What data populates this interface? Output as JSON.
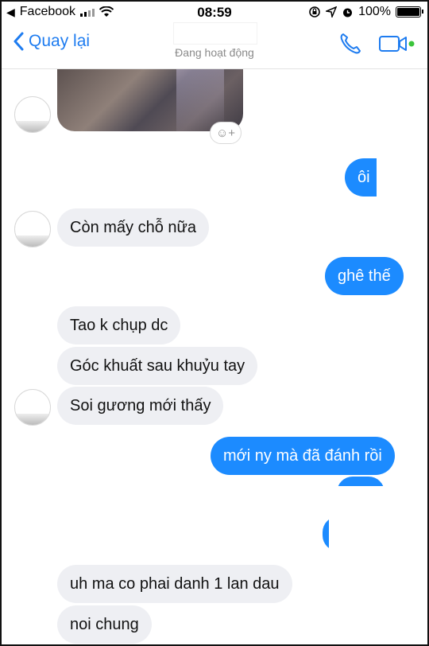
{
  "status_bar": {
    "carrier": "Facebook",
    "time": "08:59",
    "battery": "100%"
  },
  "nav": {
    "back_label": "Quay lại",
    "active_status": "Đang hoạt động"
  },
  "messages": [
    {
      "side": "in",
      "text": "Còn mấy chỗ nữa"
    },
    {
      "side": "out",
      "text": "ôi"
    },
    {
      "side": "out",
      "text": "ghê thế"
    },
    {
      "side": "in",
      "text": "Tao k chụp dc"
    },
    {
      "side": "in",
      "text": "Góc khuất sau khuỷu tay"
    },
    {
      "side": "in",
      "text": "Soi gương mới thấy"
    },
    {
      "side": "out",
      "text": "mới ny mà đã đánh rồi"
    },
    {
      "side": "in",
      "text": "uh ma co phai danh 1 lan dau"
    },
    {
      "side": "in",
      "text": "noi chung"
    }
  ],
  "colors": {
    "accent": "#1e7cf0",
    "outgoing_bubble": "#1c8bff",
    "incoming_bubble": "#eeeff3",
    "active_dot": "#3bc43b"
  },
  "icons": {
    "back": "chevron-left-icon",
    "call": "phone-icon",
    "video": "video-camera-icon",
    "reaction": "emoji-add-icon",
    "wifi": "wifi-icon",
    "location": "location-arrow-icon",
    "alarm": "alarm-clock-icon",
    "lock": "rotation-lock-icon"
  }
}
